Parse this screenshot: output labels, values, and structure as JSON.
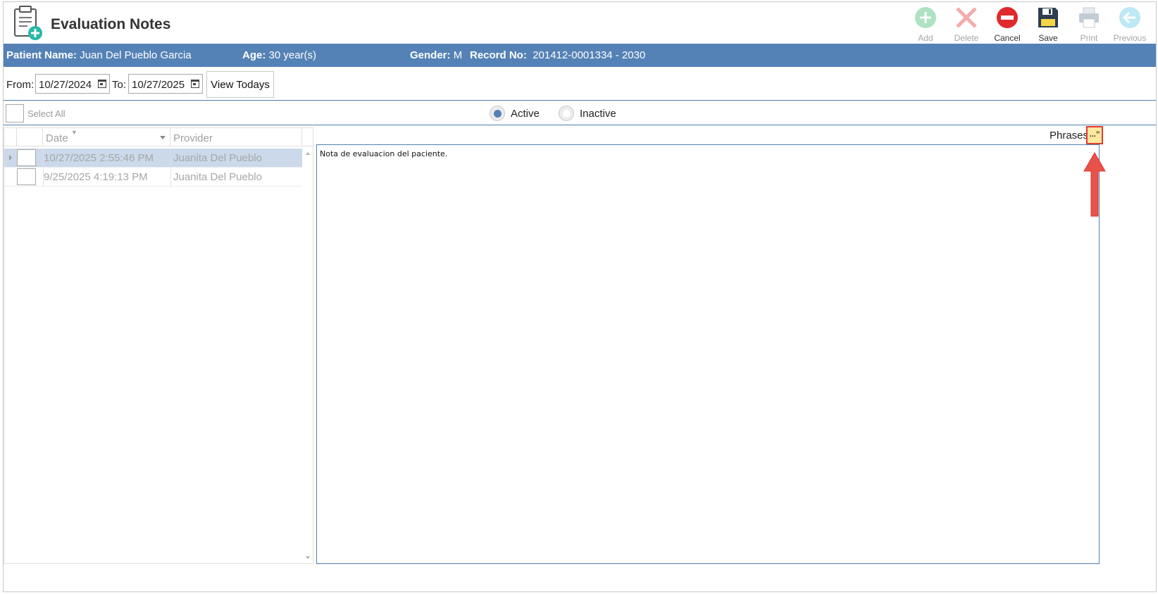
{
  "app": {
    "title": "Evaluation Notes"
  },
  "toolbar": {
    "add": "Add",
    "delete": "Delete",
    "cancel": "Cancel",
    "save": "Save",
    "print": "Print",
    "previous": "Previous"
  },
  "patient": {
    "name_label": "Patient Name:",
    "name": "Juan Del Pueblo Garcia",
    "age_label": "Age:",
    "age": "30 year(s)",
    "gender_label": "Gender:",
    "gender": "M",
    "record_label": "Record No:",
    "record": "201412-0001334 - 2030"
  },
  "filter": {
    "from_label": "From:",
    "from_value": "10/27/2024",
    "to_label": "To:",
    "to_value": "10/27/2025",
    "view_button": "View Todays"
  },
  "selection": {
    "select_all": "Select All",
    "active": "Active",
    "inactive": "Inactive",
    "selected": "Active"
  },
  "grid": {
    "columns": [
      "Date",
      "Provider"
    ],
    "rows": [
      {
        "date": "10/27/2025 2:55:46 PM",
        "provider": "Juanita Del Pueblo"
      },
      {
        "date": "9/25/2025 4:19:13 PM",
        "provider": "Juanita Del Pueblo"
      }
    ]
  },
  "notes": {
    "phrases_label": "Phrases",
    "phrases_button": "...”",
    "text": "Nota de evaluacion del paciente."
  },
  "colors": {
    "header_bar": "#5482b6",
    "accent_border": "#4f7fb0",
    "selected_row": "#cbd9ea",
    "highlight_red": "#e23a35"
  }
}
